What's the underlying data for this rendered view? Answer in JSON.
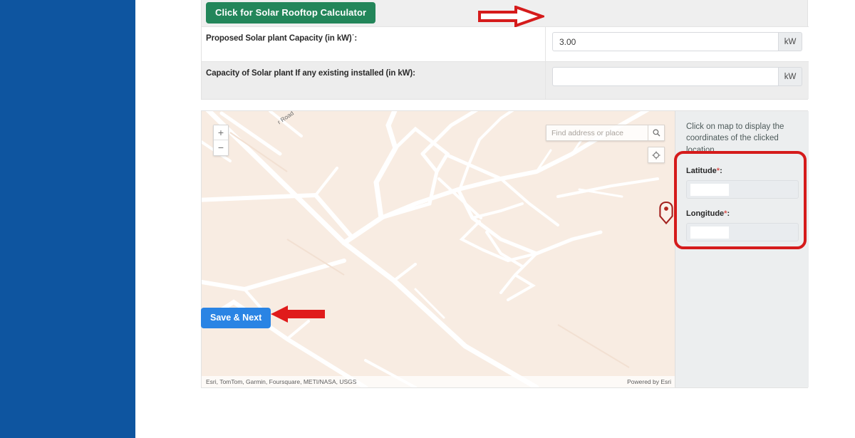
{
  "theme": {
    "sidebar_blue": "#0e55a0",
    "calc_green": "#23865a",
    "save_blue": "#2a84e4",
    "annotation_red": "#d51b1b",
    "map_land": "#f8ece2",
    "panel_gray": "#eceeef"
  },
  "form": {
    "calculator_button": "Click for Solar Rooftop Calculator",
    "rows": [
      {
        "label": "Proposed Solar plant Capacity (in kW)˙:",
        "value": "3.00",
        "placeholder": "",
        "unit": "kW"
      },
      {
        "label": "Capacity of Solar plant If any existing installed (in kW):",
        "value": "",
        "placeholder": "",
        "unit": "kW"
      }
    ]
  },
  "map": {
    "search_placeholder": "Find address or place",
    "search_value": "",
    "zoom_in": "+",
    "zoom_out": "−",
    "road_label": "r Road",
    "attribution": "Esri, TomTom, Garmin, Foursquare, METI/NASA, USGS",
    "powered_by": "Powered by Esri",
    "icons": {
      "search": "search-icon",
      "locate": "locate-crosshair-icon",
      "marker": "map-pin-marker"
    }
  },
  "coordinates_panel": {
    "hint": "Click on map to display the coordinates of the clicked location",
    "latitude_label": "Latitude",
    "latitude_required": "*",
    "latitude_suffix": ":",
    "latitude_value": "",
    "longitude_label": "Longitude",
    "longitude_required": "*",
    "longitude_suffix": ":",
    "longitude_value": ""
  },
  "footer": {
    "save_button": "Save & Next"
  },
  "annotations": [
    {
      "name": "arrow-to-capacity-field",
      "style": "outline",
      "direction": "right"
    },
    {
      "name": "arrow-to-save-button",
      "style": "solid",
      "direction": "left"
    },
    {
      "name": "box-around-coordinates",
      "style": "rounded-box"
    }
  ]
}
